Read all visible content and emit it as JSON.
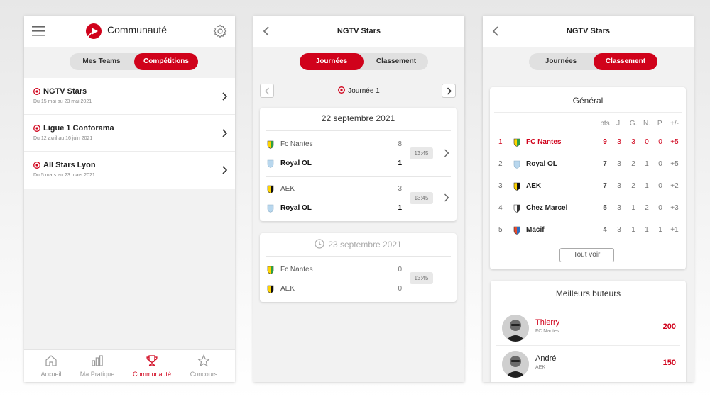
{
  "colors": {
    "accent": "#d0021b",
    "muted": "#999999"
  },
  "screen1": {
    "title": "Communauté",
    "segmented": [
      "Mes Teams",
      "Compétitions"
    ],
    "active_segment": "Compétitions",
    "competitions": [
      {
        "name": "NGTV Stars",
        "dates": "Du 15 mai au 23 mai 2021"
      },
      {
        "name": "Ligue 1 Conforama",
        "dates": "Du 12 avril au 16 juin 2021"
      },
      {
        "name": "All Stars Lyon",
        "dates": "Du 5 mars au 23 mars 2021"
      }
    ],
    "tabs": [
      {
        "label": "Accueil",
        "icon": "home-icon"
      },
      {
        "label": "Ma Pratique",
        "icon": "bar-chart-icon"
      },
      {
        "label": "Communauté",
        "icon": "trophy-icon"
      },
      {
        "label": "Concours",
        "icon": "star-icon"
      }
    ],
    "active_tab": "Communauté"
  },
  "screen2": {
    "title": "NGTV Stars",
    "segmented": [
      "Journées",
      "Classement"
    ],
    "active_segment": "Journées",
    "round_label": "Journée 1",
    "days": [
      {
        "date": "22 septembre 2021",
        "matches": [
          {
            "home": "Fc Nantes",
            "home_score": "8",
            "away": "Royal OL",
            "away_score": "1",
            "time": "13:45"
          },
          {
            "home": "AEK",
            "home_score": "3",
            "away": "Royal OL",
            "away_score": "1",
            "time": "13:45"
          }
        ]
      },
      {
        "date": "23 septembre 2021",
        "matches": [
          {
            "home": "Fc Nantes",
            "home_score": "0",
            "away": "AEK",
            "away_score": "0",
            "time": "13:45"
          }
        ]
      }
    ]
  },
  "screen3": {
    "title": "NGTV Stars",
    "segmented": [
      "Journées",
      "Classement"
    ],
    "active_segment": "Classement",
    "standings_title": "Général",
    "columns": [
      "pts",
      "J.",
      "G.",
      "N.",
      "P.",
      "+/-"
    ],
    "standings": [
      {
        "rank": "1",
        "team": "FC Nantes",
        "values": [
          "9",
          "3",
          "3",
          "0",
          "0",
          "+5"
        ]
      },
      {
        "rank": "2",
        "team": "Royal OL",
        "values": [
          "7",
          "3",
          "2",
          "1",
          "0",
          "+5"
        ]
      },
      {
        "rank": "3",
        "team": "AEK",
        "values": [
          "7",
          "3",
          "2",
          "1",
          "0",
          "+2"
        ]
      },
      {
        "rank": "4",
        "team": "Chez Marcel",
        "values": [
          "5",
          "3",
          "1",
          "2",
          "0",
          "+3"
        ]
      },
      {
        "rank": "5",
        "team": "Macif",
        "values": [
          "4",
          "3",
          "1",
          "1",
          "1",
          "+1"
        ]
      }
    ],
    "see_all": "Tout voir",
    "scorers_title": "Meilleurs buteurs",
    "scorers": [
      {
        "name": "Thierry",
        "team": "FC Nantes",
        "goals": "200"
      },
      {
        "name": "André",
        "team": "AEK",
        "goals": "150"
      }
    ]
  }
}
